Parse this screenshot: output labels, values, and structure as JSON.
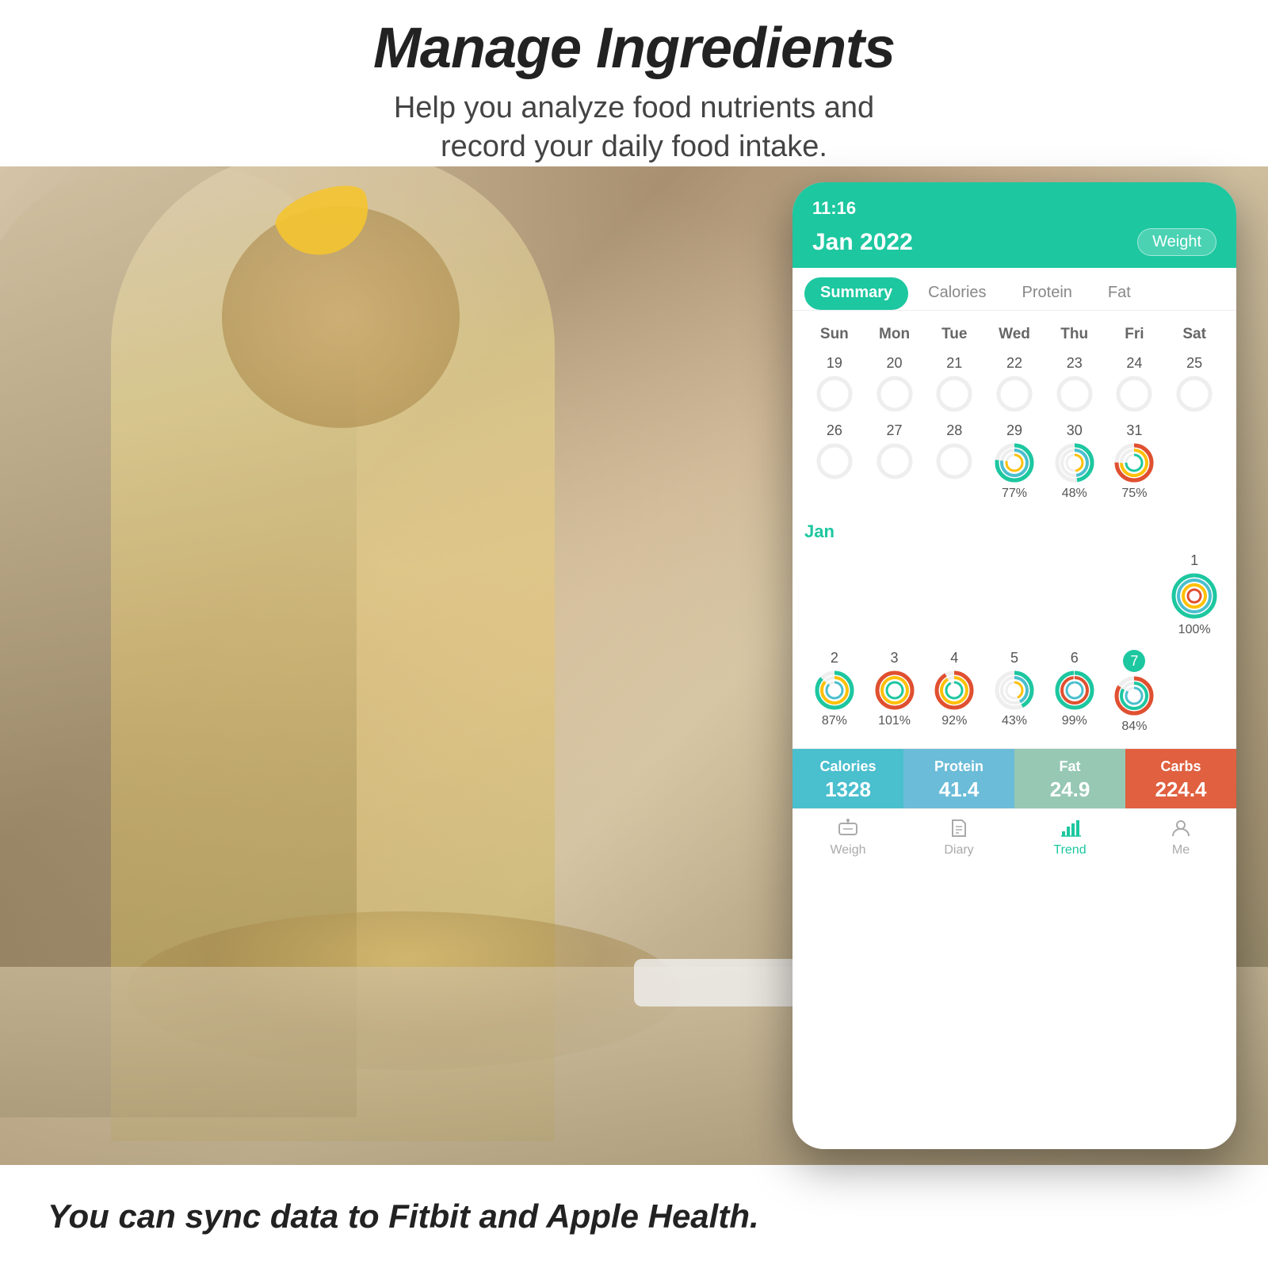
{
  "header": {
    "title": "Manage Ingredients",
    "subtitle_line1": "Help you analyze food nutrients and",
    "subtitle_line2": "record your daily food intake."
  },
  "footer": {
    "text": "You can sync data to Fitbit and Apple Health."
  },
  "app": {
    "status_bar": "11:16",
    "month": "Jan 2022",
    "weight_button": "Weight",
    "tabs": [
      "Summary",
      "Calories",
      "Protein",
      "Fat"
    ],
    "active_tab": "Summary",
    "day_headers": [
      "Sun",
      "Mon",
      "Tue",
      "Wed",
      "Thu",
      "Fri",
      "Sat"
    ],
    "week_dec": {
      "dates": [
        19,
        20,
        21,
        22,
        23,
        24,
        25
      ],
      "has_rings": [
        false,
        false,
        false,
        false,
        false,
        false,
        false
      ]
    },
    "week_dec2": {
      "dates": [
        26,
        27,
        28,
        29,
        30,
        31,
        ""
      ],
      "rings": [
        {
          "show": false,
          "pct": ""
        },
        {
          "show": false,
          "pct": ""
        },
        {
          "show": false,
          "pct": ""
        },
        {
          "show": true,
          "pct": "77%",
          "colors": [
            "#1DC7A0",
            "#4ABFCE",
            "#FFC107"
          ]
        },
        {
          "show": true,
          "pct": "48%",
          "colors": [
            "#1DC7A0",
            "#4ABFCE",
            "#FFC107"
          ]
        },
        {
          "show": true,
          "pct": "75%",
          "colors": [
            "#E05030",
            "#FFC107",
            "#1DC7A0"
          ]
        },
        {
          "show": false,
          "pct": ""
        }
      ]
    },
    "jan_label": "Jan",
    "week_jan1": {
      "dates": [
        "",
        "",
        "",
        "",
        "",
        "",
        1
      ],
      "rings": [
        {
          "show": false,
          "pct": ""
        },
        {
          "show": false,
          "pct": ""
        },
        {
          "show": false,
          "pct": ""
        },
        {
          "show": false,
          "pct": ""
        },
        {
          "show": false,
          "pct": ""
        },
        {
          "show": false,
          "pct": ""
        },
        {
          "show": true,
          "pct": "100%",
          "colors": [
            "#1DC7A0",
            "#4ABFCE",
            "#FFC107",
            "#E05030"
          ]
        }
      ]
    },
    "week_jan2": {
      "dates": [
        2,
        3,
        4,
        5,
        6,
        7,
        ""
      ],
      "today": 7,
      "rings": [
        {
          "show": true,
          "pct": "87%",
          "colors": [
            "#1DC7A0",
            "#FFC107",
            "#4ABFCE"
          ]
        },
        {
          "show": true,
          "pct": "101%",
          "colors": [
            "#E05030",
            "#FFC107",
            "#1DC7A0"
          ]
        },
        {
          "show": true,
          "pct": "92%",
          "colors": [
            "#E05030",
            "#FFC107",
            "#1DC7A0"
          ]
        },
        {
          "show": true,
          "pct": "43%",
          "colors": [
            "#1DC7A0",
            "#4ABFCE",
            "#FFC107"
          ]
        },
        {
          "show": true,
          "pct": "99%",
          "colors": [
            "#1DC7A0",
            "#E05030",
            "#4ABFCE"
          ]
        },
        {
          "show": true,
          "pct": "84%",
          "colors": [
            "#E05030",
            "#1DC7A0",
            "#4ABFCE"
          ]
        },
        {
          "show": false,
          "pct": ""
        }
      ]
    },
    "stats": [
      {
        "label": "Calories",
        "value": "1328",
        "type": "calories"
      },
      {
        "label": "Protein",
        "value": "41.4",
        "type": "protein"
      },
      {
        "label": "Fat",
        "value": "24.9",
        "type": "fat"
      },
      {
        "label": "Carbs",
        "value": "224.4",
        "type": "carbs"
      }
    ],
    "nav": [
      {
        "label": "Weigh",
        "active": false
      },
      {
        "label": "Diary",
        "active": false
      },
      {
        "label": "Trend",
        "active": true
      },
      {
        "label": "Me",
        "active": false
      }
    ]
  }
}
